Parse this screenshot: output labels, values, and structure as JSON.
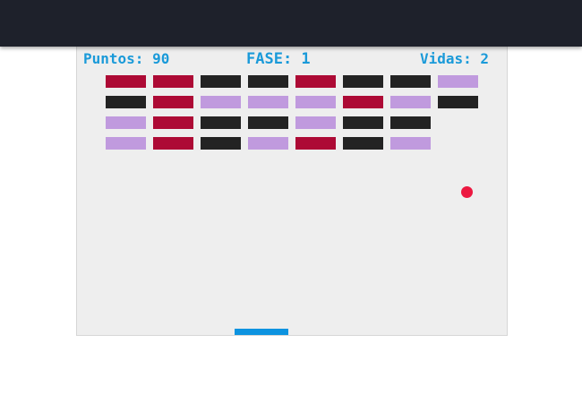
{
  "hud": {
    "score_label": "Puntos: 90",
    "level_label": "FASE: 1",
    "lives_label": "Vidas: 2"
  },
  "colors": {
    "topbar": "#1e212b",
    "field_background": "#eeeeee",
    "hud_text": "#1a9ad9",
    "brick_crimson": "#ad0a35",
    "brick_black": "#232323",
    "brick_lavender": "#c09ade",
    "ball": "#ec1840",
    "paddle": "#0d93e0"
  },
  "bricks": {
    "rows": [
      [
        "crimson",
        "crimson",
        "black",
        "black",
        "crimson",
        "black",
        "black",
        "lavender"
      ],
      [
        "black",
        "crimson",
        "lavender",
        "lavender",
        "lavender",
        "crimson",
        "lavender",
        "black"
      ],
      [
        "lavender",
        "crimson",
        "black",
        "black",
        "lavender",
        "black",
        "black",
        null
      ],
      [
        "lavender",
        "crimson",
        "black",
        "lavender",
        "crimson",
        "black",
        "lavender",
        null
      ]
    ]
  }
}
